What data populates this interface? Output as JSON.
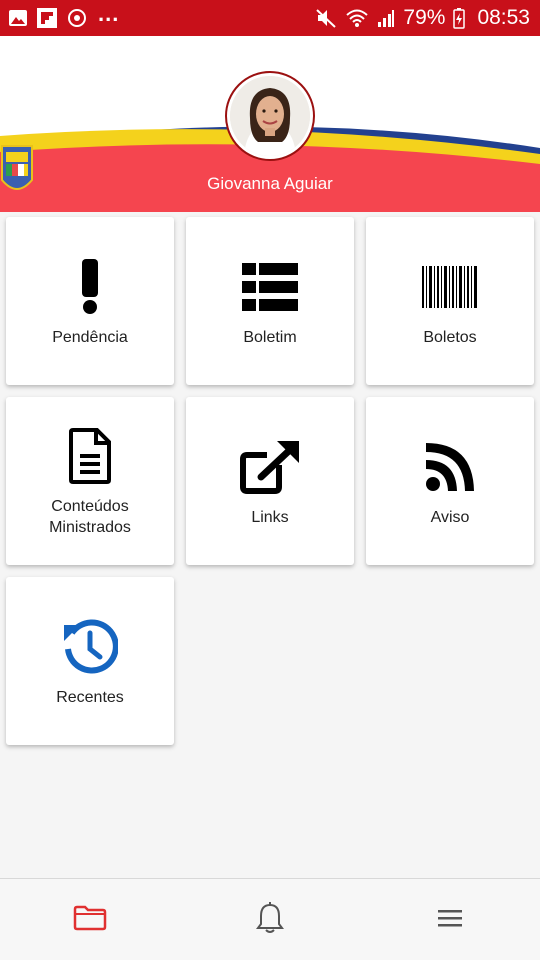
{
  "status_bar": {
    "battery": "79%",
    "time": "08:53",
    "more": "...",
    "background": "#c8101a"
  },
  "profile": {
    "name": "Giovanna Aguiar"
  },
  "menu": {
    "items": [
      {
        "label": "Pendência",
        "icon": "exclamation-icon"
      },
      {
        "label": "Boletim",
        "icon": "table-list-icon"
      },
      {
        "label": "Boletos",
        "icon": "barcode-icon"
      },
      {
        "label": "Conteúdos Ministrados",
        "icon": "document-icon"
      },
      {
        "label": "Links",
        "icon": "external-link-icon"
      },
      {
        "label": "Aviso",
        "icon": "rss-icon"
      },
      {
        "label": "Recentes",
        "icon": "history-icon"
      }
    ]
  },
  "bottom_nav": {
    "items": [
      {
        "icon": "folder-icon",
        "active": true
      },
      {
        "icon": "bell-icon",
        "active": false
      },
      {
        "icon": "menu-icon",
        "active": false
      }
    ]
  },
  "colors": {
    "header_red": "#f5454f",
    "header_yellow": "#f4d21c",
    "header_blue": "#23418f",
    "active_nav": "#e03030",
    "history_blue": "#1565c0"
  }
}
